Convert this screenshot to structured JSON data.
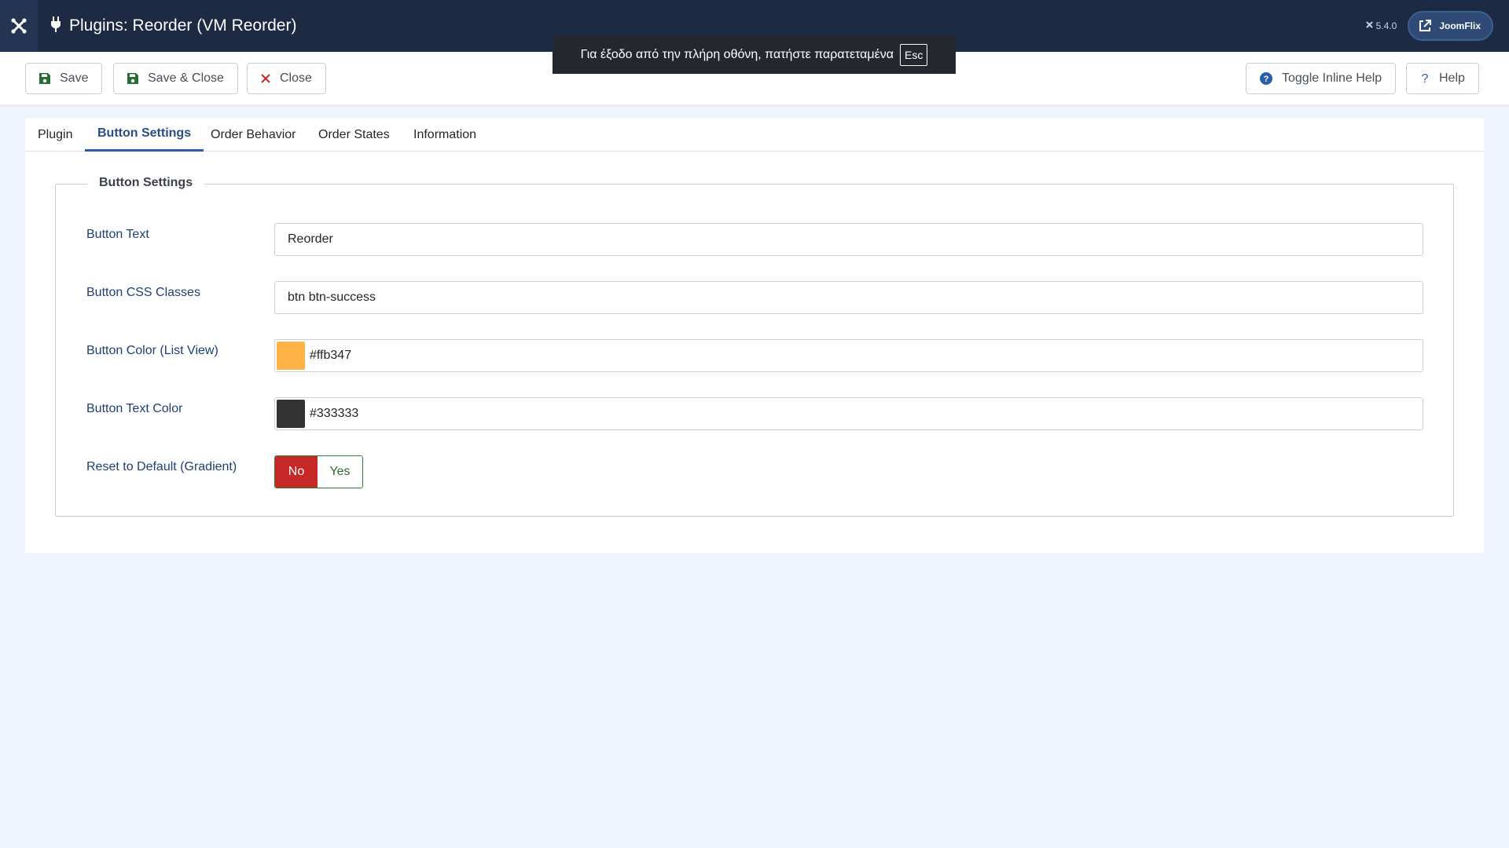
{
  "header": {
    "title": "Plugins: Reorder (VM Reorder)",
    "version": "5.4.0",
    "site_button_label": "JoomFlix",
    "logo_icon": "joomla-logo-icon",
    "title_icon": "plug-icon"
  },
  "fullscreen_notice": {
    "message": "Για έξοδο από την πλήρη οθόνη, πατήστε παρατεταμένα",
    "key": "Esc"
  },
  "toolbar": {
    "save_label": "Save",
    "save_close_label": "Save & Close",
    "close_label": "Close",
    "toggle_help_label": "Toggle Inline Help",
    "help_label": "Help"
  },
  "tabs": [
    {
      "label": "Plugin",
      "active": false
    },
    {
      "label": "Button Settings",
      "active": true
    },
    {
      "label": "Order Behavior",
      "active": false
    },
    {
      "label": "Order States",
      "active": false
    },
    {
      "label": "Information",
      "active": false
    }
  ],
  "form": {
    "legend": "Button Settings",
    "fields": {
      "button_text": {
        "label": "Button Text",
        "value": "Reorder"
      },
      "css_classes": {
        "label": "Button CSS Classes",
        "value": "btn btn-success"
      },
      "list_color": {
        "label": "Button Color (List View)",
        "value": "#ffb347"
      },
      "text_color": {
        "label": "Button Text Color",
        "value": "#333333"
      },
      "reset_default": {
        "label": "Reset to Default (Gradient)",
        "no_label": "No",
        "yes_label": "Yes",
        "selected": "No"
      }
    }
  },
  "colors": {
    "header_bg": "#1c2a43",
    "accent": "#2a4d84",
    "danger": "#c52827",
    "success": "#2e7d32"
  }
}
